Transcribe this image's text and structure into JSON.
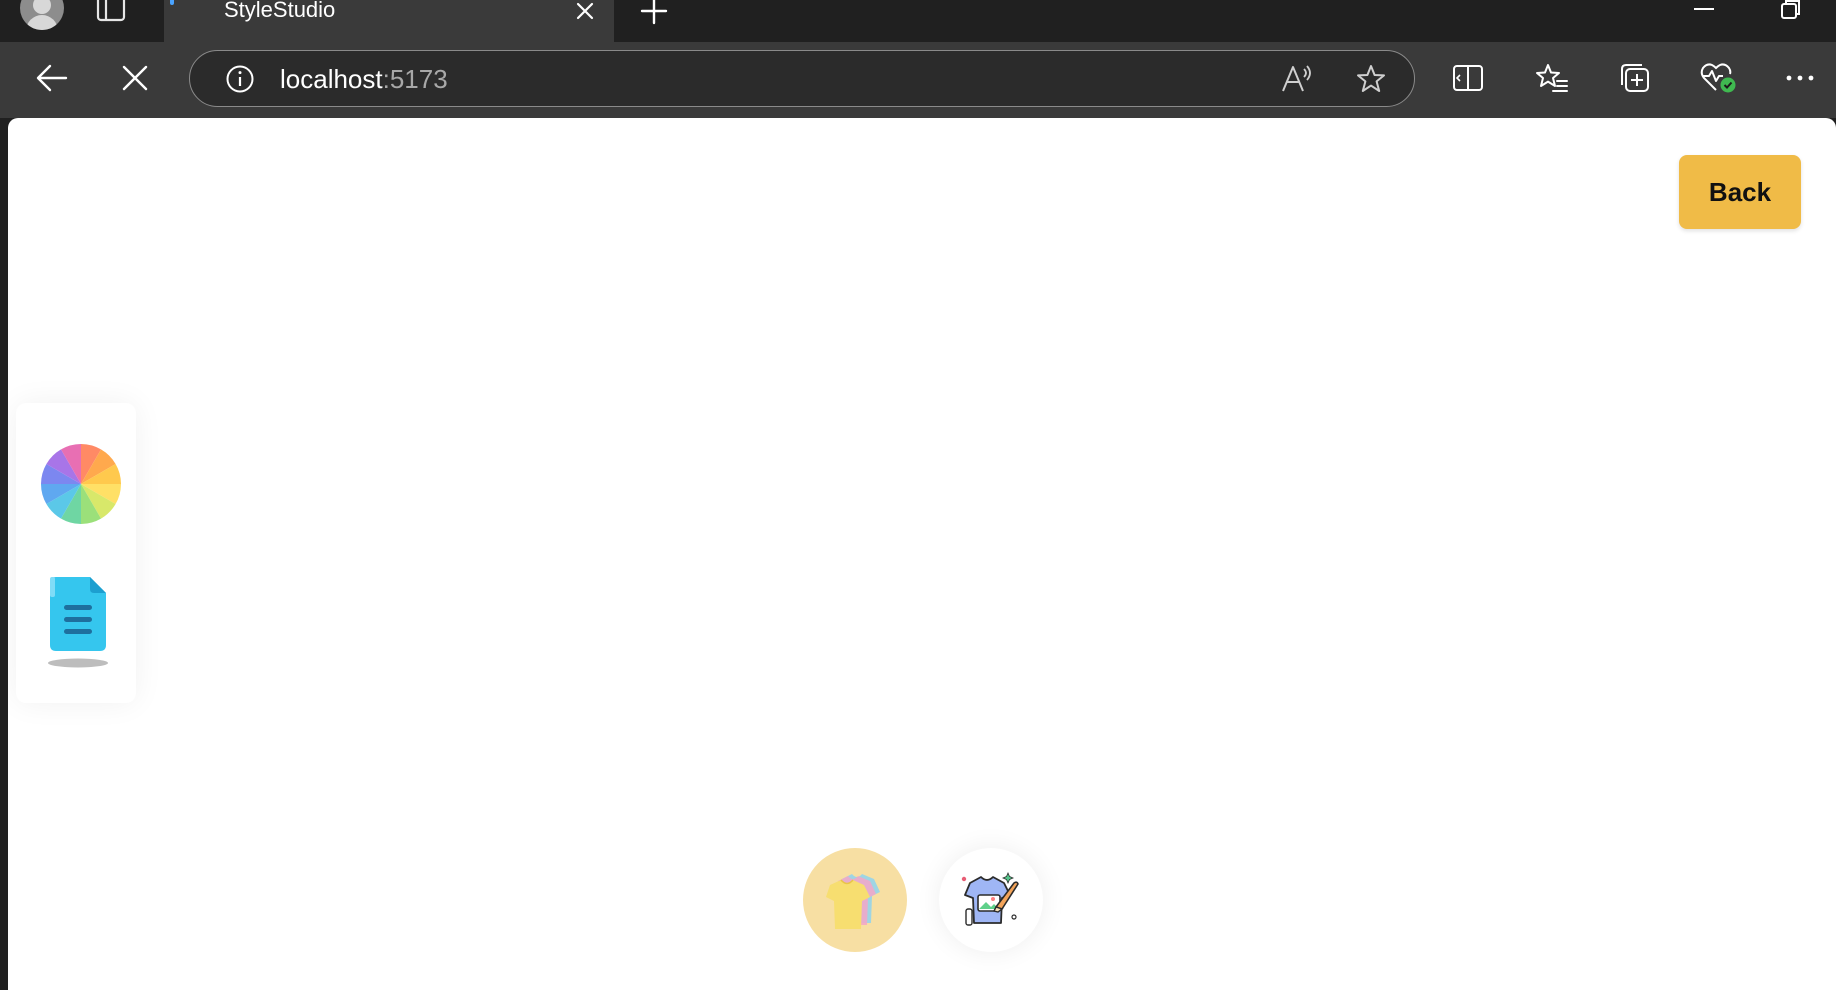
{
  "browser": {
    "tab": {
      "title": "StyleStudio"
    },
    "address": {
      "host": "localhost",
      "port": ":5173"
    },
    "icons": {
      "profile": "profile-avatar-icon",
      "tab_actions": "tab-actions-icon",
      "tab_close": "close-icon",
      "new_tab": "plus-icon",
      "minimize": "minimize-icon",
      "restore": "restore-icon",
      "back": "back-arrow-icon",
      "stop": "stop-icon",
      "site_info": "info-icon",
      "read_aloud": "read-aloud-icon",
      "favorite": "star-icon",
      "split_screen": "split-screen-icon",
      "favorites": "favorites-icon",
      "collections": "collections-icon",
      "browser_essentials": "heart-pulse-icon",
      "more": "more-icon"
    }
  },
  "page": {
    "back_button": {
      "label": "Back",
      "color": "#f0bb47"
    },
    "left_toolbar": {
      "items": [
        {
          "icon": "color-wheel-icon"
        },
        {
          "icon": "document-icon"
        }
      ]
    },
    "bottom_bar": {
      "items": [
        {
          "icon": "tshirts-icon",
          "active": true,
          "color": "#f7dfa3"
        },
        {
          "icon": "tshirt-design-icon",
          "active": false
        }
      ]
    }
  }
}
